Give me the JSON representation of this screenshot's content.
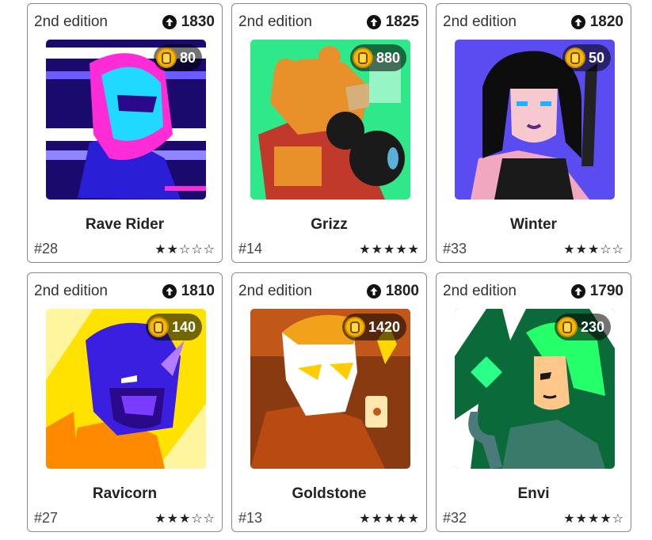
{
  "cards": [
    {
      "edition": "2nd edition",
      "score": "1830",
      "price": "80",
      "name": "Rave Rider",
      "number": "#28",
      "rating": "★★☆☆☆"
    },
    {
      "edition": "2nd edition",
      "score": "1825",
      "price": "880",
      "name": "Grizz",
      "number": "#14",
      "rating": "★★★★★"
    },
    {
      "edition": "2nd edition",
      "score": "1820",
      "price": "50",
      "name": "Winter",
      "number": "#33",
      "rating": "★★★☆☆"
    },
    {
      "edition": "2nd edition",
      "score": "1810",
      "price": "140",
      "name": "Ravicorn",
      "number": "#27",
      "rating": "★★★☆☆"
    },
    {
      "edition": "2nd edition",
      "score": "1800",
      "price": "1420",
      "name": "Goldstone",
      "number": "#13",
      "rating": "★★★★★"
    },
    {
      "edition": "2nd edition",
      "score": "1790",
      "price": "230",
      "name": "Envi",
      "number": "#32",
      "rating": "★★★★☆"
    }
  ],
  "icons": {
    "score": "arrow-up-circle-icon",
    "price": "coin-icon"
  },
  "colors": {
    "border": "#8a8a8a",
    "coin": "#f5b800",
    "badge": "rgba(0,0,0,0.55)"
  }
}
